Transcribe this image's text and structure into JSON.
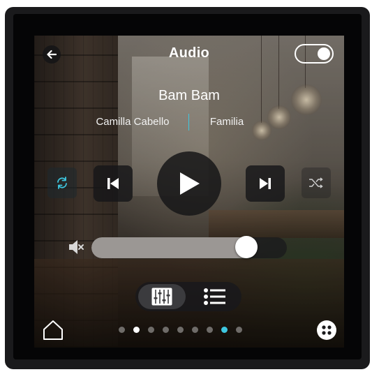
{
  "header": {
    "title": "Audio",
    "back_icon": "arrow-left-icon",
    "power_toggle_on": true
  },
  "now_playing": {
    "track": "Bam Bam",
    "artist": "Camilla Cabello",
    "album": "Familia"
  },
  "controls": {
    "repeat_icon": "repeat-icon",
    "prev_icon": "skip-previous-icon",
    "play_icon": "play-icon",
    "next_icon": "skip-next-icon",
    "shuffle_icon": "shuffle-icon",
    "repeat_active": true
  },
  "volume": {
    "icon": "speaker-muted-icon",
    "level_percent": 80
  },
  "view_switch": {
    "options": [
      "equalizer-icon",
      "list-icon"
    ],
    "selected": "equalizer-icon"
  },
  "pager": {
    "count": 9,
    "current": 1,
    "highlighted": 7
  },
  "footer": {
    "home_icon": "home-icon",
    "apps_icon": "apps-icon"
  },
  "colors": {
    "accent": "#3ec7e0",
    "text": "#ffffff",
    "dot_inactive": "#6f6c69",
    "dot_current": "#ffffff"
  }
}
